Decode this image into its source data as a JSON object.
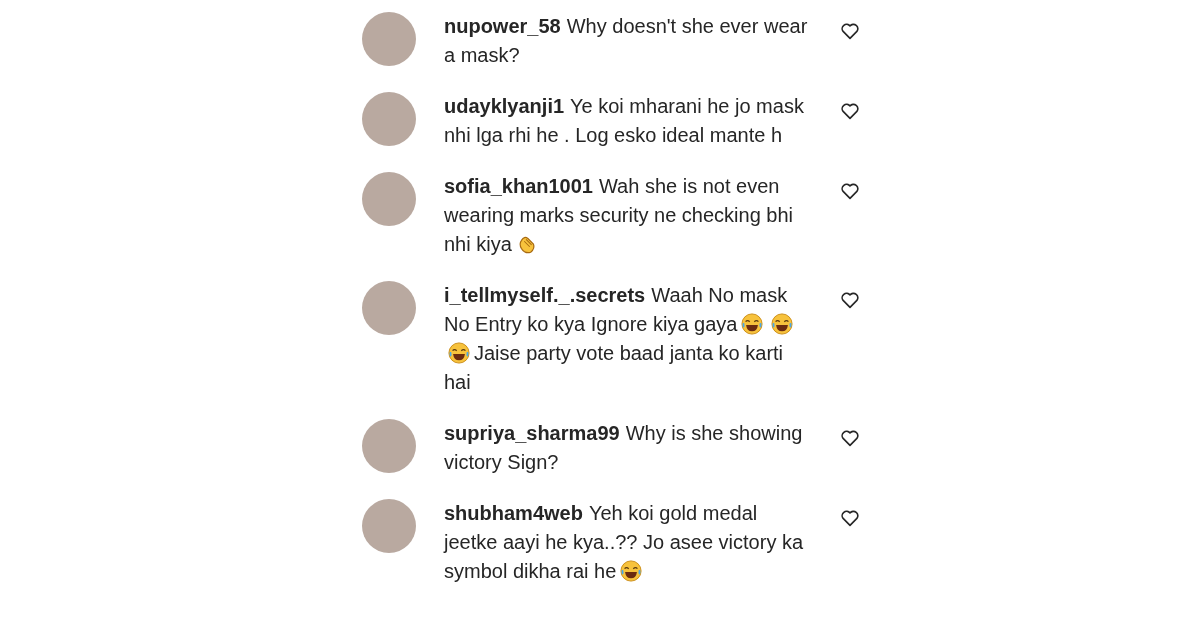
{
  "comments": [
    {
      "username": "nupower_58",
      "parts": [
        {
          "kind": "text",
          "text": "Why doesn't she ever wear a mask?"
        }
      ],
      "liked": false
    },
    {
      "username": "udayklyanji1",
      "parts": [
        {
          "kind": "text",
          "text": "Ye koi mharani he jo mask nhi lga rhi he . Log esko ideal mante h"
        }
      ],
      "liked": false
    },
    {
      "username": "sofia_khan1001",
      "parts": [
        {
          "kind": "text",
          "text": "Wah she is not even wearing marks security ne checking bhi nhi kiya"
        },
        {
          "kind": "clap"
        }
      ],
      "liked": false
    },
    {
      "username": "i_tellmyself._.secrets",
      "parts": [
        {
          "kind": "text",
          "text": "Waah No mask No Entry ko kya Ignore kiya gaya"
        },
        {
          "kind": "laugh"
        },
        {
          "kind": "laugh"
        },
        {
          "kind": "laugh"
        },
        {
          "kind": "text",
          "text": "Jaise party vote baad janta ko karti hai"
        }
      ],
      "liked": false
    },
    {
      "username": "supriya_sharma99",
      "parts": [
        {
          "kind": "text",
          "text": "Why is she showing victory Sign?"
        }
      ],
      "liked": false
    },
    {
      "username": "shubham4web",
      "parts": [
        {
          "kind": "text",
          "text": "Yeh koi gold medal jeetke aayi he kya..?? Jo asee victory ka symbol dikha rai he"
        },
        {
          "kind": "laugh"
        }
      ],
      "liked": false
    }
  ]
}
